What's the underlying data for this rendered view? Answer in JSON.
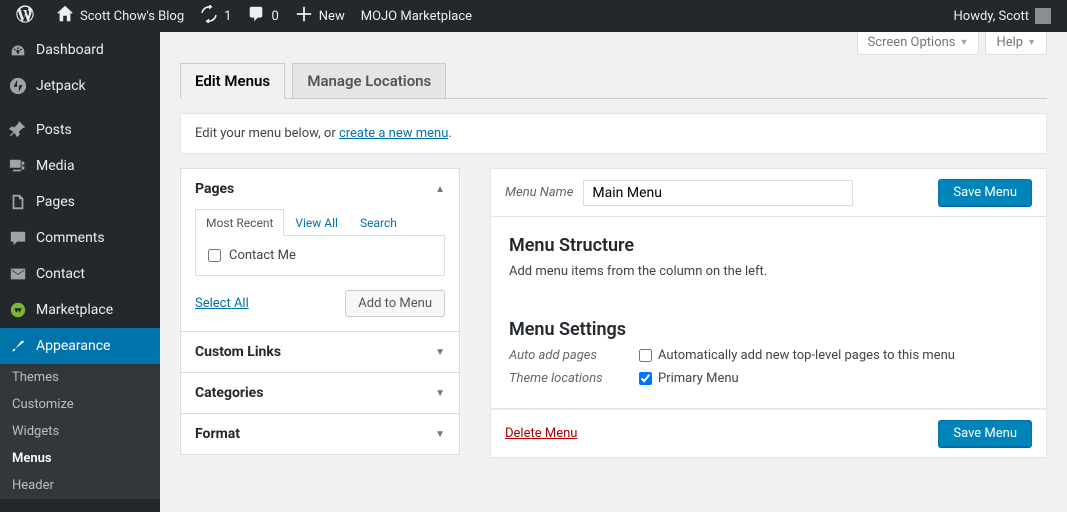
{
  "adminbar": {
    "site_name": "Scott Chow's Blog",
    "updates_count": "1",
    "comments_count": "0",
    "new_label": "New",
    "mojo_label": "MOJO Marketplace",
    "howdy": "Howdy, Scott"
  },
  "screen_meta": {
    "screen_options": "Screen Options",
    "help": "Help"
  },
  "sidebar": {
    "items": [
      {
        "label": "Dashboard"
      },
      {
        "label": "Jetpack"
      },
      {
        "label": "Posts"
      },
      {
        "label": "Media"
      },
      {
        "label": "Pages"
      },
      {
        "label": "Comments"
      },
      {
        "label": "Contact"
      },
      {
        "label": "Marketplace"
      },
      {
        "label": "Appearance"
      }
    ],
    "submenu": [
      {
        "label": "Themes"
      },
      {
        "label": "Customize"
      },
      {
        "label": "Widgets"
      },
      {
        "label": "Menus"
      },
      {
        "label": "Header"
      }
    ]
  },
  "tabs": {
    "edit": "Edit Menus",
    "locations": "Manage Locations"
  },
  "manage_text_prefix": "Edit your menu below, or ",
  "manage_link": "create a new menu",
  "accordion": {
    "pages": {
      "title": "Pages",
      "tabs": {
        "recent": "Most Recent",
        "all": "View All",
        "search": "Search"
      },
      "items": [
        "Contact Me"
      ],
      "select_all": "Select All",
      "add_btn": "Add to Menu"
    },
    "links": {
      "title": "Custom Links"
    },
    "categories": {
      "title": "Categories"
    },
    "format": {
      "title": "Format"
    }
  },
  "menu_edit": {
    "name_label": "Menu Name",
    "name_value": "Main Menu",
    "save_btn": "Save Menu",
    "structure_heading": "Menu Structure",
    "structure_hint": "Add menu items from the column on the left.",
    "settings_heading": "Menu Settings",
    "auto_add_label": "Auto add pages",
    "auto_add_text": "Automatically add new top-level pages to this menu",
    "locations_label": "Theme locations",
    "primary_text": "Primary Menu",
    "delete_link": "Delete Menu"
  }
}
